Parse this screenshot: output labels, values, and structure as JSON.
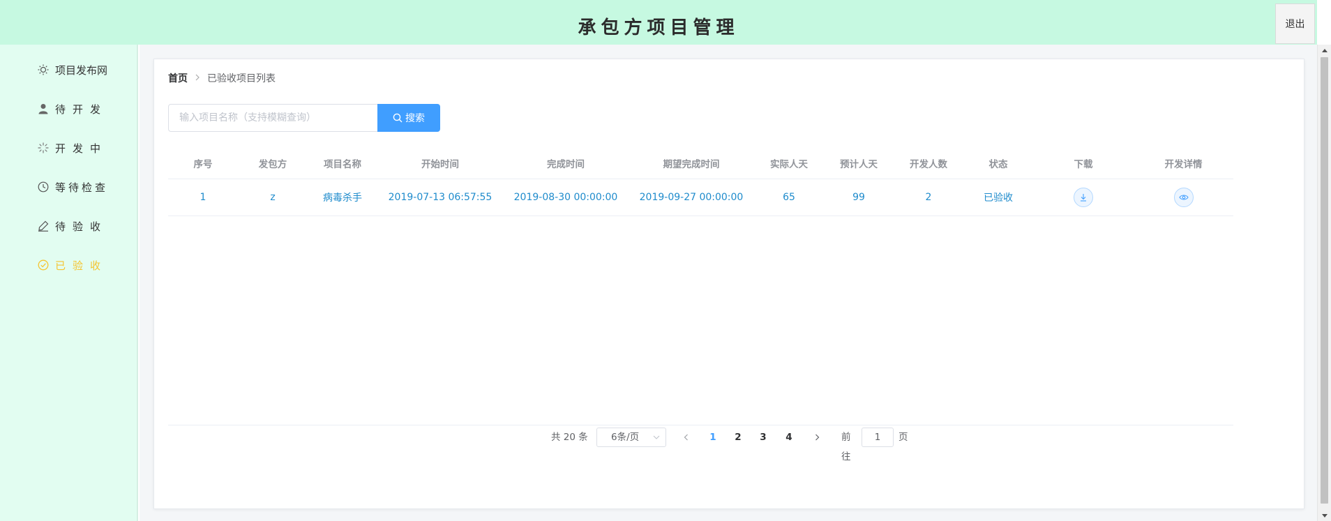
{
  "header": {
    "title": "承包方项目管理",
    "logout_label": "退出"
  },
  "sidebar": {
    "items": [
      {
        "label": "项目发布网",
        "icon": "sun-icon",
        "active": false
      },
      {
        "label": "待开发",
        "icon": "user-icon",
        "active": false
      },
      {
        "label": "开发中",
        "icon": "loading-icon",
        "active": false
      },
      {
        "label": "等待检查",
        "icon": "clock-icon",
        "active": false
      },
      {
        "label": "待验收",
        "icon": "edit-icon",
        "active": false
      },
      {
        "label": "已验收",
        "icon": "circle-check-icon",
        "active": true
      }
    ],
    "active_color": "#f5c531"
  },
  "breadcrumb": {
    "home": "首页",
    "separator": ">",
    "current": "已验收项目列表"
  },
  "search": {
    "placeholder": "输入项目名称（支持模糊查询）",
    "value": "",
    "button_label": "搜索"
  },
  "table": {
    "columns": [
      "序号",
      "发包方",
      "项目名称",
      "开始时间",
      "完成时间",
      "期望完成时间",
      "实际人天",
      "预计人天",
      "开发人数",
      "状态",
      "下载",
      "开发详情"
    ],
    "rows": [
      {
        "index": "1",
        "client": "z",
        "name": "病毒杀手",
        "start_time": "2019-07-13 06:57:55",
        "finish_time": "2019-08-30 00:00:00",
        "expected_time": "2019-09-27 00:00:00",
        "actual_days": "65",
        "estimated_days": "99",
        "developers": "2",
        "status": "已验收",
        "download_icon": "download-icon",
        "detail_icon": "eye-icon"
      }
    ]
  },
  "pagination": {
    "total_text": "共 20 条",
    "page_size": "6条/页",
    "pages": [
      "1",
      "2",
      "3",
      "4"
    ],
    "current_page": "1",
    "goto_prefix": "前往",
    "goto_value": "1",
    "goto_suffix": "页"
  },
  "colors": {
    "header_bg": "#c6f9e1",
    "sidebar_bg": "#e2fdf1",
    "primary": "#409eff",
    "row_text": "#1e8bcc"
  }
}
